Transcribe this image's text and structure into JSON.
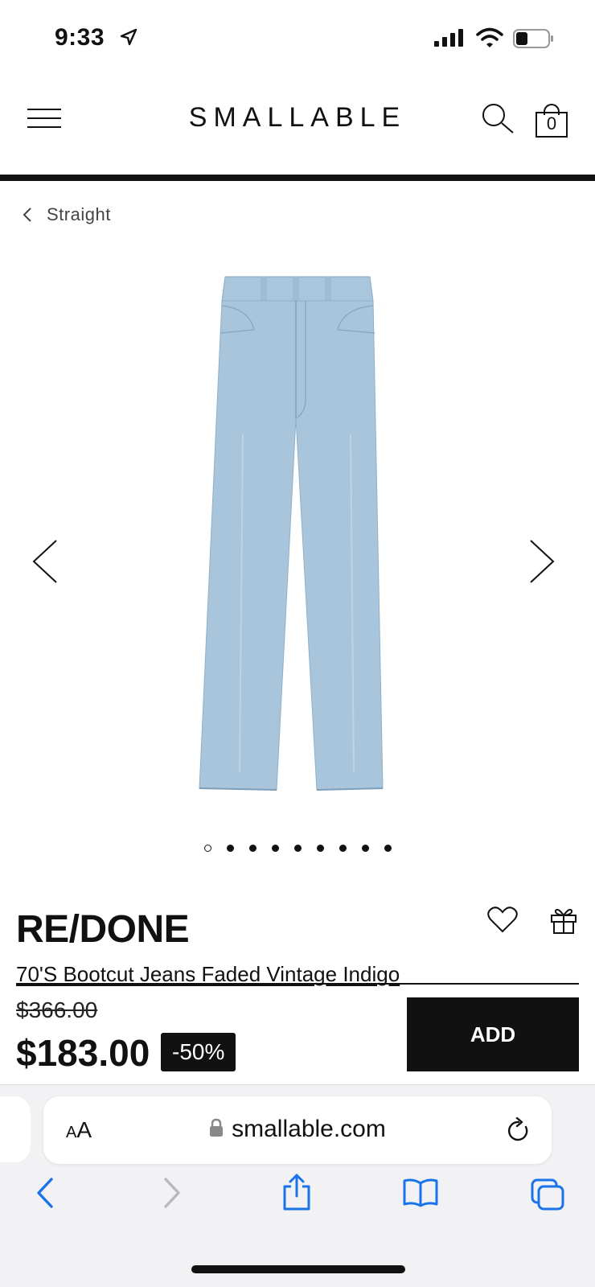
{
  "status_bar": {
    "time": "9:33",
    "icons": [
      "location-arrow-icon",
      "signal-icon",
      "wifi-icon",
      "battery-icon"
    ]
  },
  "header": {
    "brand": "SMALLABLE",
    "cart_count": "0",
    "icons": [
      "menu-icon",
      "search-icon",
      "bag-icon"
    ]
  },
  "breadcrumb": {
    "label": "Straight"
  },
  "gallery": {
    "total_images": 9,
    "active_index": 0,
    "image_subject": "light wash bootcut jeans",
    "denim_color": "#a9c5dc"
  },
  "product": {
    "brand": "RE/DONE",
    "title": "70'S Bootcut Jeans Faded Vintage Indigo",
    "old_price": "$366.00",
    "price": "$183.00",
    "discount": "-50%",
    "add_label": "ADD"
  },
  "browser": {
    "aa_label_small": "A",
    "aa_label_large": "A",
    "url": "smallable.com",
    "accent": "#1a73e8"
  }
}
